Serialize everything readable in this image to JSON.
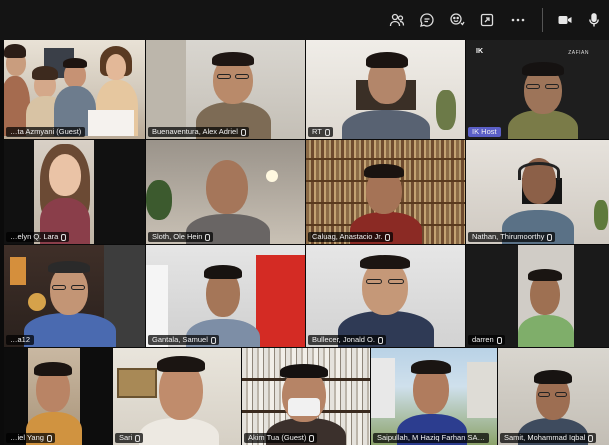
{
  "toolbar": {
    "icons": [
      "people-icon",
      "chat-icon",
      "reactions-icon",
      "share-tray-icon",
      "more-options-icon",
      "camera-icon",
      "mic-icon"
    ]
  },
  "participants": [
    {
      "name": "…ta Azmyani (Guest)"
    },
    {
      "name": "Buenaventura, Alex Adriel"
    },
    {
      "name": "RT"
    },
    {
      "name": "IK Host",
      "host": true,
      "brand": "IK",
      "brand_right": "ZAFIAN"
    },
    {
      "name": "…elyn Q. Lara"
    },
    {
      "name": "Sloth, Ole Hein"
    },
    {
      "name": "Caluag, Anastacio Jr."
    },
    {
      "name": "Nathan, Thirumoorthy"
    },
    {
      "name": "…a12"
    },
    {
      "name": "Gantala, Samuel"
    },
    {
      "name": "Bullecer, Jonald O."
    },
    {
      "name": "darren"
    },
    {
      "name": "…iel Yang"
    },
    {
      "name": "Sari"
    },
    {
      "name": "Akim Tua (Guest)"
    },
    {
      "name": "Saipullah, M Haziq Farhan SA…"
    },
    {
      "name": "Samit, Mohammad Iqbal"
    }
  ]
}
